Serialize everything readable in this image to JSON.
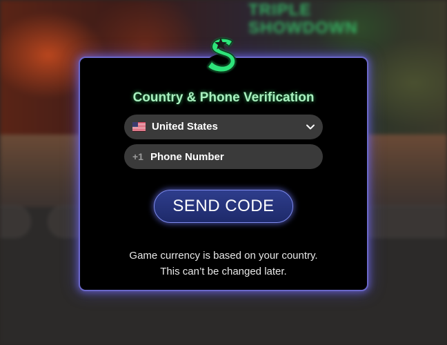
{
  "background": {
    "promo_title_line1": "TRIPLE",
    "promo_title_line2": "SHOWDOWN"
  },
  "modal": {
    "title": "Country & Phone Verification",
    "country_select": {
      "selected": "United States",
      "flag_icon": "us-flag-icon"
    },
    "phone_field": {
      "dial_code": "+1",
      "placeholder": "Phone Number",
      "value": ""
    },
    "send_button_label": "SEND CODE",
    "footnote_line1": "Game currency is based on your country.",
    "footnote_line2": "This can’t be changed later."
  },
  "colors": {
    "modal_border": "#6b68c9",
    "title_green": "#a9f0bf",
    "logo_green": "#2ee37a",
    "button_fill": "#1e2a6a"
  }
}
